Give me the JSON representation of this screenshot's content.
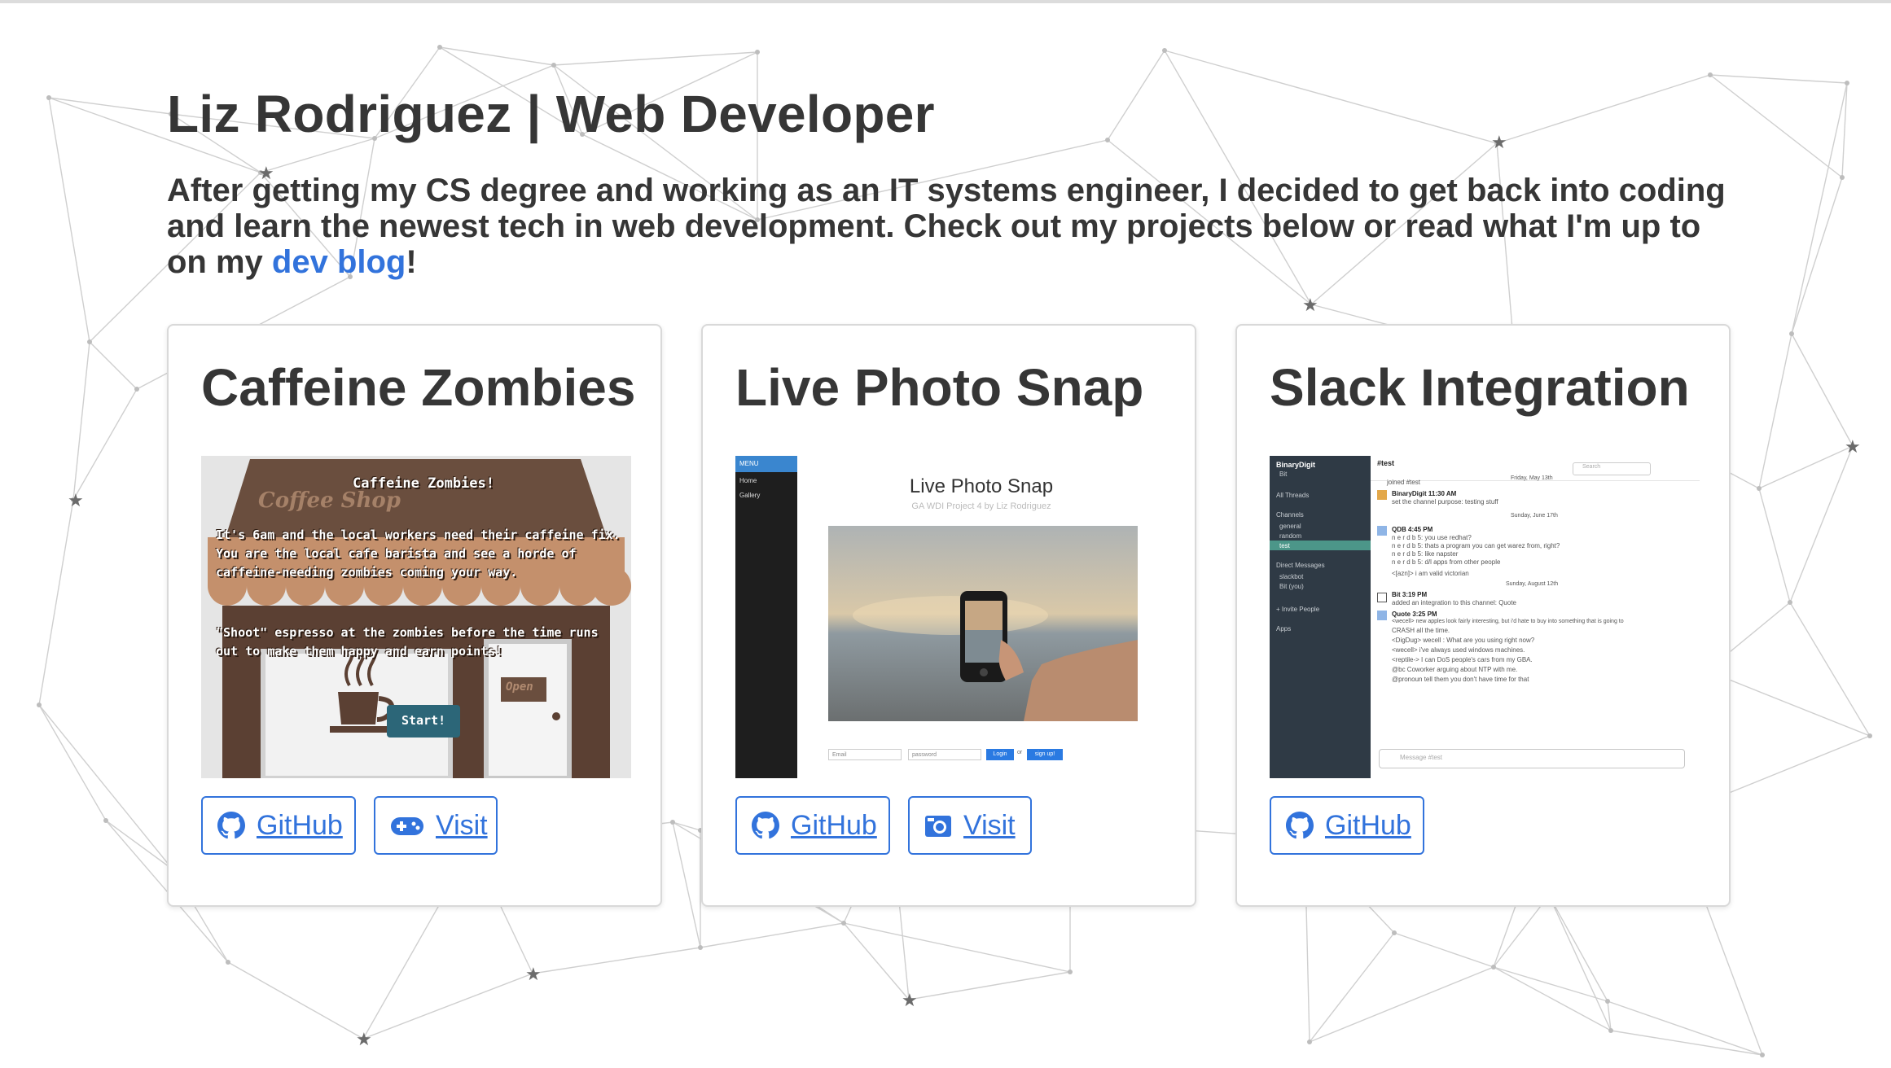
{
  "header": {
    "title": "Liz Rodriguez | Web Developer",
    "intro_text": "After getting my CS degree and working as an IT systems engineer, I decided to get back into coding and learn the newest tech in web development. Check out my projects below or read what I'm up to on my ",
    "blog_link": "dev blog",
    "intro_end": "!"
  },
  "colors": {
    "link": "#3273dc",
    "text": "#363636",
    "card_border": "#d9d9d9"
  },
  "projects": [
    {
      "title": "Caffeine Zombies",
      "github_label": "GitHub",
      "visit_label": "Visit",
      "visit_icon": "gamepad-icon",
      "screenshot": {
        "sign": "Coffee Shop",
        "heading": "Caffeine Zombies!",
        "para1": "It's 6am and the local workers need their caffeine fix. You are the local cafe barista and see a horde of caffeine-needing zombies coming your way.",
        "para2": "\"Shoot\" espresso at the zombies before the time runs out to make them happy and earn points!",
        "start_label": "Start!",
        "door_sign": "Open"
      }
    },
    {
      "title": "Live Photo Snap",
      "github_label": "GitHub",
      "visit_label": "Visit",
      "visit_icon": "camera-icon",
      "screenshot": {
        "menu_label": "MENU",
        "menu_items": [
          "Home",
          "Gallery"
        ],
        "app_title": "Live Photo Snap",
        "subtitle": "GA WDI Project 4 by Liz Rodriguez",
        "email_placeholder": "Email",
        "password_placeholder": "password",
        "login_label": "Login",
        "or_label": "or",
        "signup_label": "sign up!"
      }
    },
    {
      "title": "Slack Integration",
      "github_label": "GitHub",
      "screenshot": {
        "team_name": "BinaryDigit",
        "user": "Bit",
        "all_threads": "All Threads",
        "channels_label": "Channels",
        "channels": [
          "general",
          "random",
          "test"
        ],
        "dm_label": "Direct Messages",
        "dms": [
          "slackbot",
          "Bit (you)"
        ],
        "invite_label": "+ Invite People",
        "apps_label": "Apps",
        "channel_header": "#test",
        "search_placeholder": "Search",
        "date1": "Friday, May 13th",
        "date2": "Sunday, June 17th",
        "date3": "Sunday, August 12th",
        "msgs": [
          "joined #test",
          "BinaryDigit 11:30 AM",
          "set the channel purpose: testing stuff",
          "QDB 4:45 PM",
          "n e r d b 5: you use redhat?",
          "n e r d b 5: thats a program you can get warez from, right?",
          "n e r d b 5: like napster",
          "n e r d b 5: d/l apps from other people",
          "<[azn]> i am valid victorian",
          "Bit 3:19 PM",
          "added an integration to this channel: Quote",
          "Quote 3:25 PM",
          "<wecell> new apples look fairly interesting, but i'd hate to buy into something that is going to",
          "CRASH all the time.",
          "<DigDug> wecell : What are you using right now?",
          "<wecell> i've always used windows machines.",
          "<reptile-> I can DoS people's cars from my GBA.",
          "@bc Coworker arguing about NTP with me.",
          "@pronoun tell them you don't have time for that"
        ],
        "message_placeholder": "Message #test"
      }
    }
  ]
}
